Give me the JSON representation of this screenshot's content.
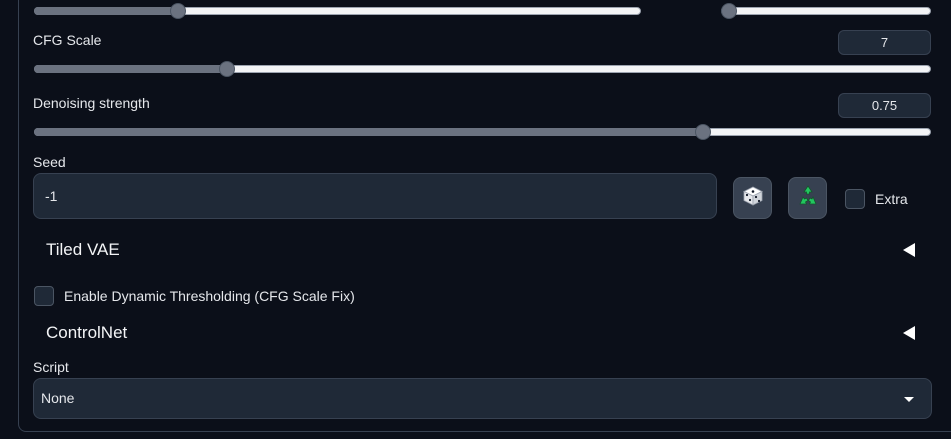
{
  "colors": {
    "background": "#0b0f19",
    "input_bg": "#1f2937",
    "border": "#374151",
    "slider_fill": "#6b7280",
    "track": "#f3f4f6"
  },
  "sliders": {
    "top_left": {
      "fraction": 0.23
    },
    "top_right": {
      "fraction": 0.0
    },
    "cfg": {
      "label": "CFG Scale",
      "value": "7",
      "fraction": 0.21
    },
    "denoise": {
      "label": "Denoising strength",
      "value": "0.75",
      "fraction": 0.75
    }
  },
  "seed": {
    "label": "Seed",
    "value": "-1",
    "random_icon": "dice-icon",
    "reuse_icon": "recycle-icon",
    "extra_label": "Extra",
    "extra_checked": false
  },
  "tiled_vae": {
    "title": "Tiled VAE",
    "icon": "collapse-triangle-icon"
  },
  "dynamic_thresholding": {
    "label": "Enable Dynamic Thresholding (CFG Scale Fix)",
    "checked": false
  },
  "controlnet": {
    "title": "ControlNet",
    "icon": "collapse-triangle-icon"
  },
  "script": {
    "label": "Script",
    "selected": "None",
    "icon": "dropdown-caret-icon"
  }
}
